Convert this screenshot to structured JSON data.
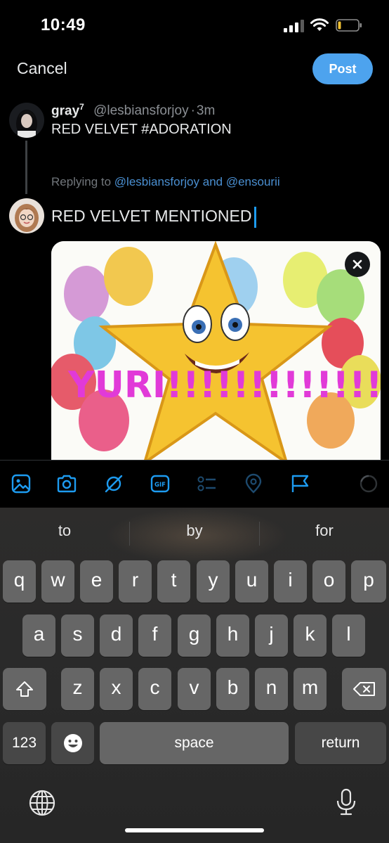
{
  "status_bar": {
    "time": "10:49"
  },
  "header": {
    "cancel_label": "Cancel",
    "post_label": "Post"
  },
  "original_tweet": {
    "name": "gray",
    "name_sup": "7",
    "handle": "@lesbiansforjoy",
    "dot": "·",
    "age": "3m",
    "text": "RED VELVET #ADORATION"
  },
  "replying": {
    "prefix": "Replying to",
    "mention1": "@lesbiansforjoy",
    "and": "and",
    "mention2": "@ensourii"
  },
  "reply": {
    "text": "RED VELVET MENTIONED"
  },
  "media": {
    "overlay_text": "YURI!!!!!!!!!!!!!!!!!"
  },
  "toolbar": {
    "icons": [
      "image-icon",
      "camera-icon",
      "grok-icon",
      "gif-icon",
      "poll-icon",
      "location-icon",
      "flag-icon",
      "progress-ring-icon"
    ],
    "gif_label": "GIF"
  },
  "keyboard": {
    "suggestions": [
      "to",
      "by",
      "for"
    ],
    "row1": [
      "q",
      "w",
      "e",
      "r",
      "t",
      "y",
      "u",
      "i",
      "o",
      "p"
    ],
    "row2": [
      "a",
      "s",
      "d",
      "f",
      "g",
      "h",
      "j",
      "k",
      "l"
    ],
    "row3": [
      "z",
      "x",
      "c",
      "v",
      "b",
      "n",
      "m"
    ],
    "numbers_label": "123",
    "space_label": "space",
    "return_label": "return"
  },
  "colors": {
    "accent": "#4da3ee",
    "mention": "#4a8fd1",
    "background": "#000000"
  }
}
